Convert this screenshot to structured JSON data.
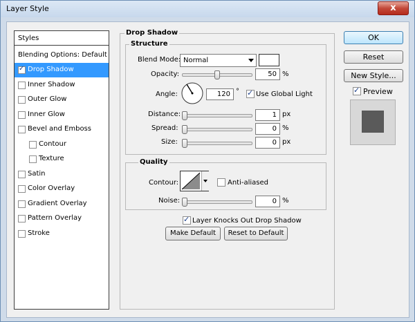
{
  "window": {
    "title": "Layer Style",
    "close_glyph": "x"
  },
  "styles_list": {
    "header": "Styles",
    "blending_options": "Blending Options: Default",
    "items": [
      {
        "label": "Drop Shadow",
        "checked": true,
        "selected": true
      },
      {
        "label": "Inner Shadow",
        "checked": false
      },
      {
        "label": "Outer Glow",
        "checked": false
      },
      {
        "label": "Inner Glow",
        "checked": false
      },
      {
        "label": "Bevel and Emboss",
        "checked": false
      },
      {
        "label": "Contour",
        "checked": false,
        "indent": true
      },
      {
        "label": "Texture",
        "checked": false,
        "indent": true
      },
      {
        "label": "Satin",
        "checked": false
      },
      {
        "label": "Color Overlay",
        "checked": false
      },
      {
        "label": "Gradient Overlay",
        "checked": false
      },
      {
        "label": "Pattern Overlay",
        "checked": false
      },
      {
        "label": "Stroke",
        "checked": false
      }
    ]
  },
  "drop_shadow": {
    "title": "Drop Shadow",
    "structure": {
      "title": "Structure",
      "blend_mode": {
        "label": "Blend Mode:",
        "value": "Normal",
        "color": "#ffffff"
      },
      "opacity": {
        "label": "Opacity:",
        "value": "50",
        "unit": "%",
        "slider_fraction": 0.5
      },
      "angle": {
        "label": "Angle:",
        "value": "120",
        "unit": "°",
        "use_global_light": {
          "label": "Use Global Light",
          "checked": true
        }
      },
      "distance": {
        "label": "Distance:",
        "value": "1",
        "unit": "px",
        "slider_fraction": 0
      },
      "spread": {
        "label": "Spread:",
        "value": "0",
        "unit": "%",
        "slider_fraction": 0
      },
      "size": {
        "label": "Size:",
        "value": "0",
        "unit": "px",
        "slider_fraction": 0
      }
    },
    "quality": {
      "title": "Quality",
      "contour": {
        "label": "Contour:",
        "anti_aliased": {
          "label": "Anti-aliased",
          "checked": false
        }
      },
      "noise": {
        "label": "Noise:",
        "value": "0",
        "unit": "%",
        "slider_fraction": 0
      }
    },
    "layer_knocks_out": {
      "label": "Layer Knocks Out Drop Shadow",
      "checked": true
    },
    "make_default": "Make Default",
    "reset_to_default": "Reset to Default"
  },
  "buttons": {
    "ok": "OK",
    "reset": "Reset",
    "new_style": "New Style...",
    "preview": {
      "label": "Preview",
      "checked": true
    }
  },
  "colors": {
    "selection": "#3399ff",
    "preview_swatch": "#5a5a5a"
  }
}
